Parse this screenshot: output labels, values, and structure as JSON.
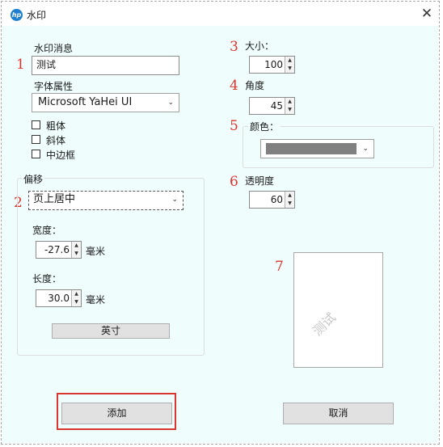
{
  "window": {
    "title": "水印",
    "logo_text": "hp",
    "close_glyph": "✕"
  },
  "markers": [
    "1",
    "2",
    "3",
    "4",
    "5",
    "6",
    "7"
  ],
  "watermark": {
    "message_label": "水印消息",
    "message_value": "测试",
    "font_label": "字体属性",
    "font_value": "Microsoft YaHei UI",
    "bold_label": "粗体",
    "bold_checked": false,
    "italic_label": "斜体",
    "italic_checked": false,
    "outline_label": "中边框",
    "outline_checked": false
  },
  "offset": {
    "group_label": "偏移",
    "position_value": "页上居中",
    "width_label": "宽度：",
    "width_value": "-27.6",
    "width_unit": "毫米",
    "length_label": "长度：",
    "length_value": "30.0",
    "length_unit": "毫米",
    "unit_button": "英寸"
  },
  "size": {
    "label": "大小：",
    "value": "100"
  },
  "angle": {
    "label": "角度",
    "value": "45"
  },
  "color": {
    "label": "颜色：",
    "swatch": "#808080"
  },
  "opacity": {
    "label": "透明度",
    "value": "60"
  },
  "preview": {
    "text": "测试",
    "angle": 45
  },
  "buttons": {
    "add": "添加",
    "cancel": "取消"
  },
  "colors": {
    "marker_red": "#d9362f",
    "client_bg": "#f0fdfd",
    "highlight_border": "#d9362f"
  },
  "icons": {
    "dropdown": "chevron-down-icon",
    "spin_up": "spin-up-icon",
    "spin_down": "spin-down-icon",
    "close": "close-icon"
  }
}
